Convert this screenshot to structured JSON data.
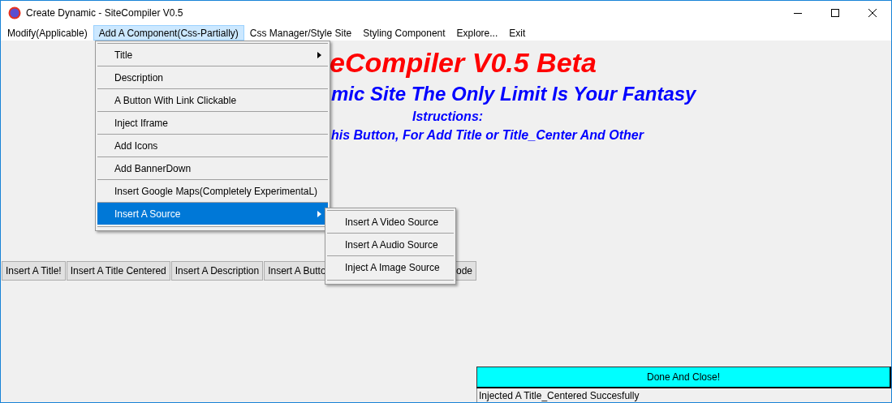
{
  "window": {
    "title": "Create Dynamic - SiteCompiler V0.5"
  },
  "menu_bar": [
    {
      "label": "Modify(Applicable)",
      "selected": false
    },
    {
      "label": "Add A Component(Css-Partially)",
      "selected": true
    },
    {
      "label": "Css Manager/Style Site",
      "selected": false
    },
    {
      "label": "Styling Component",
      "selected": false
    },
    {
      "label": "Explore...",
      "selected": false
    },
    {
      "label": "Exit",
      "selected": false
    }
  ],
  "dropdown": {
    "items": [
      {
        "label": "Title",
        "has_submenu": true,
        "selected": false
      },
      {
        "label": "Description",
        "has_submenu": false,
        "selected": false
      },
      {
        "label": "A Button With Link Clickable",
        "has_submenu": false,
        "selected": false
      },
      {
        "label": "Inject Iframe",
        "has_submenu": false,
        "selected": false
      },
      {
        "label": "Add Icons",
        "has_submenu": false,
        "selected": false
      },
      {
        "label": "Add BannerDown",
        "has_submenu": false,
        "selected": false
      },
      {
        "label": "Insert Google Maps(Completely ExperimentaL)",
        "has_submenu": false,
        "selected": false
      },
      {
        "label": "Insert A Source",
        "has_submenu": true,
        "selected": true
      }
    ]
  },
  "submenu": {
    "items": [
      {
        "label": "Insert A Video Source",
        "selected": false
      },
      {
        "label": "Insert A Audio Source",
        "selected": false
      },
      {
        "label": "Inject A Image Source",
        "selected": false
      }
    ]
  },
  "heading": {
    "title": "eCompiler V0.5 Beta",
    "subtitle": "mic Site The Only Limit Is Your Fantasy",
    "instructions_label": "Istructions:",
    "instructions": "his Button, For Add Title or Title_Center And Other"
  },
  "buttons": [
    "Insert A Title!",
    "Insert A Title Centered",
    "Insert A Description",
    "Insert A Butto",
    "ode"
  ],
  "done_button": "Done And Close!",
  "status_bar": "Injected A Title_Centered Succesfully"
}
